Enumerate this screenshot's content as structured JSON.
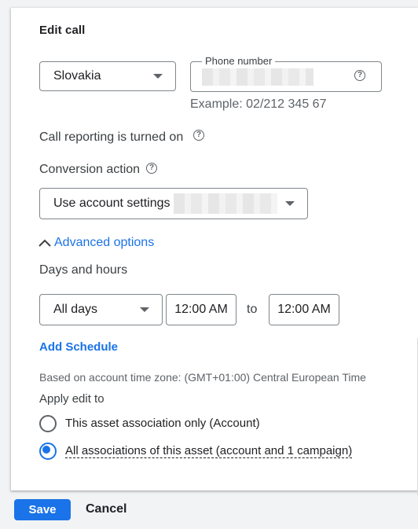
{
  "dialog": {
    "title": "Edit call"
  },
  "phone": {
    "country": "Slovakia",
    "number_label": "Phone number",
    "example": "Example: 02/212 345 67"
  },
  "call_reporting": {
    "text": "Call reporting is turned on"
  },
  "conversion": {
    "label": "Conversion action",
    "value": "Use account settings"
  },
  "advanced": {
    "toggle_label": "Advanced options"
  },
  "schedule": {
    "label": "Days and hours",
    "days": "All days",
    "start": "12:00 AM",
    "to": "to",
    "end": "12:00 AM",
    "add_label": "Add Schedule",
    "timezone": "Based on account time zone: (GMT+01:00) Central European Time"
  },
  "apply": {
    "label": "Apply edit to",
    "options": [
      {
        "label": "This asset association only (Account)",
        "selected": false
      },
      {
        "label": "All associations of this asset (account and 1 campaign)",
        "selected": true
      }
    ]
  },
  "footer": {
    "save": "Save",
    "cancel": "Cancel"
  },
  "colors": {
    "accent": "#1a73e8",
    "border": "#80868b",
    "text": "#3c4043"
  }
}
